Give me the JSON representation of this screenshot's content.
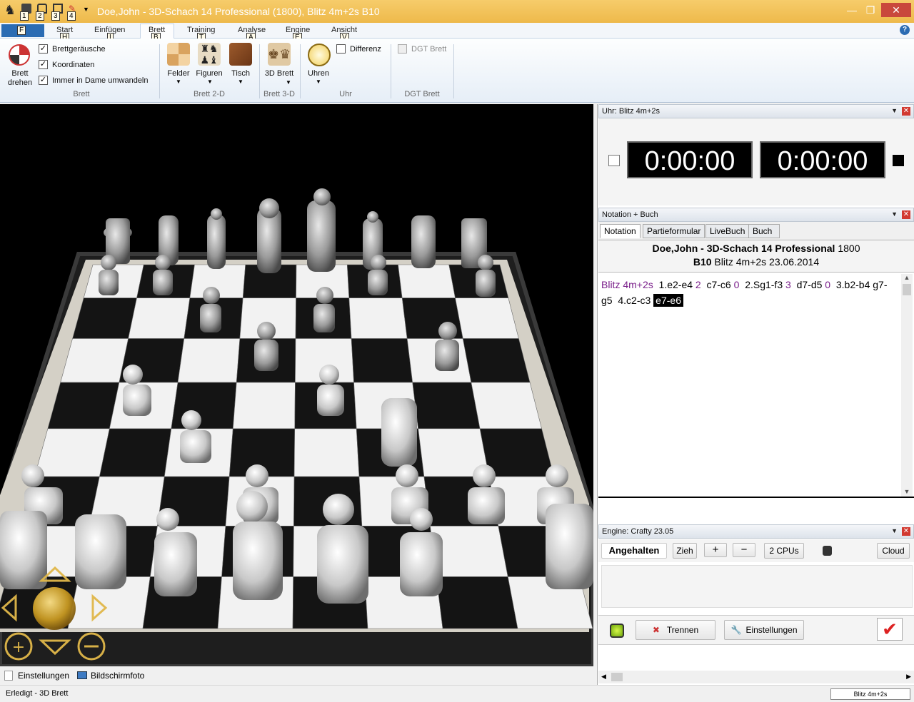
{
  "window": {
    "title": "Doe,John - 3D-Schach 14 Professional (1800), Blitz 4m+2s  B10",
    "min": "—",
    "max": "❐",
    "close": "✕"
  },
  "keytips": {
    "qa1": "1",
    "qa2": "2",
    "qa3": "3",
    "qa4": "4",
    "file": "F",
    "start": "H",
    "einfuegen": "I",
    "brett": "B",
    "training": "T",
    "analyse": "A",
    "engine": "E",
    "ansicht": "V"
  },
  "menu": {
    "tabs": [
      "Start",
      "Einfügen",
      "Brett",
      "Training",
      "Analyse",
      "Engine",
      "Ansicht"
    ],
    "help": "?"
  },
  "ribbon": {
    "brett_drehen": "Brett drehen",
    "checks": [
      "Brettgeräusche",
      "Koordinaten",
      "Immer in Dame umwandeln"
    ],
    "group_brett": "Brett",
    "felder": "Felder",
    "figuren": "Figuren",
    "tisch": "Tisch",
    "group_2d": "Brett 2-D",
    "brett3d": "3D Brett",
    "group_3d": "Brett 3-D",
    "uhren": "Uhren",
    "differenz": "Differenz",
    "group_uhr": "Uhr",
    "dgt_brett": "DGT Brett",
    "group_dgt": "DGT Brett"
  },
  "clock_panel": {
    "title": "Uhr: Blitz 4m+2s",
    "white_time": "0:00:00",
    "black_time": "0:00:00"
  },
  "notation_panel": {
    "title": "Notation + Buch",
    "tabs": [
      "Notation",
      "Partieformular",
      "LiveBuch",
      "Buch"
    ],
    "players": "Doe,John - 3D-Schach 14 Professional",
    "elo": "1800",
    "eco": "B10",
    "event_date": "Blitz 4m+2s 23.06.2014",
    "event": "Blitz 4m+2s",
    "moves": [
      {
        "move": "1.e2-e4",
        "time": "2"
      },
      {
        "move": "c7-c6",
        "time": "0"
      },
      {
        "move": "2.Sg1-f3",
        "time": "3"
      },
      {
        "move": "d7-d5",
        "time": "0"
      },
      {
        "move": "3.b2-b4",
        "time": ""
      },
      {
        "move": "g7-g5",
        "time": ""
      },
      {
        "move": "4.c2-c3",
        "time": ""
      }
    ],
    "current_move": "e7-e6"
  },
  "engine_panel": {
    "title": "Engine: Crafty 23.05",
    "status": "Angehalten",
    "zieh": "Zieh",
    "plus": "+",
    "minus": "−",
    "cpus": "2 CPUs",
    "cloud": "Cloud",
    "trennen": "Trennen",
    "einstellungen": "Einstellungen"
  },
  "bottom": {
    "einstellungen": "Einstellungen",
    "bildschirmfoto": "Bildschirmfoto",
    "status": "Erledigt - 3D Brett",
    "mode": "Blitz 4m+2s"
  },
  "colors": {
    "titlebar": "#eeb94b",
    "accent": "#2b6cb3",
    "move_time": "#7a1f8a"
  }
}
